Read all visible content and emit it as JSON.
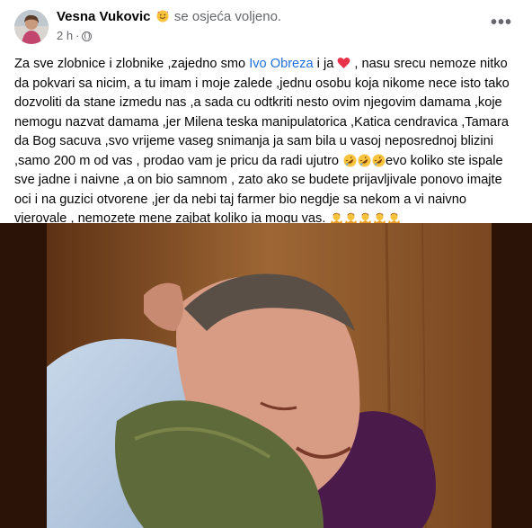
{
  "post": {
    "author": "Vesna Vukovic",
    "feeling": "se osjeća voljeno.",
    "time": "2 h",
    "separator": "·",
    "more_label": "•••",
    "text": {
      "p1": "Za sve zlobnice i zlobnike ,zajedno smo ",
      "mention": "Ivo Obreza",
      "p2": "  i ja ",
      "p3": " , nasu srecu nemoze nitko\nda pokvari sa nicim, a tu imam i moje zalede ,jednu osobu koja nikome nece isto tako\ndozvoliti da stane izmedu nas ,a  sada cu odtkriti nesto ovim njegovim damama ,koje\nnemogu nazvat damama ,jer Milena teska manipulatorica ,Katica cendravica ,Tamara\nda Bog sacuva  ,svo vrijeme vaseg snimanja ja sam bila u vasoj neposrednoj blizini\n,samo 200 m od vas , prodao vam je pricu da radi ujutro ",
      "p4": "evo koliko ste ispale\nsve jadne i naivne ,a on bio samnom , zato ako se budete prijavljivale ponovo imajte\noci i na guzici otvorene ,jer da nebi taj farmer bio negdje sa nekom a vi naivno\nvjerovale , nemozete mene zajbat koliko ja mogu vas. "
    },
    "icons": {
      "feeling_emoji": "smiling-face-with-hearts-icon",
      "heart": "red-heart-icon",
      "laughing": "rolling-on-floor-laughing-icon",
      "shrug": "person-shrugging-icon",
      "privacy": "globe-icon"
    },
    "colors": {
      "mention": "#216fdb",
      "heart": "#e8334a",
      "meta": "#65676b"
    }
  }
}
